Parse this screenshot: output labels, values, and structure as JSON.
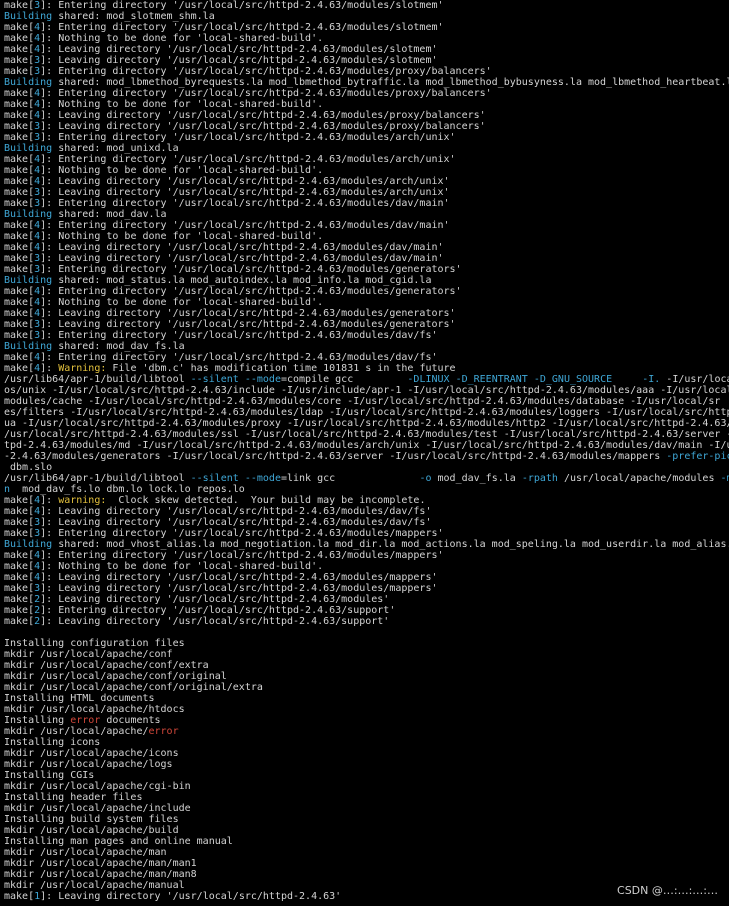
{
  "colors": {
    "background": "#000000",
    "text": "#d4d4d4",
    "accent_blue": "#3fa7d6",
    "warning_yellow": "#e3c13d",
    "error_red": "#d0473a"
  },
  "watermark": "CSDN @…:…:…:…",
  "lines": [
    [
      {
        "t": "make[",
        "c": "txt"
      },
      {
        "t": "3",
        "c": "num"
      },
      {
        "t": "]: Entering directory '/usr/local/src/httpd-2.4.63/modules/slotmem'",
        "c": "txt"
      }
    ],
    [
      {
        "t": "Building",
        "c": "build"
      },
      {
        "t": " shared: mod_slotmem_shm.la",
        "c": "txt"
      }
    ],
    [
      {
        "t": "make[",
        "c": "txt"
      },
      {
        "t": "4",
        "c": "num"
      },
      {
        "t": "]: Entering directory '/usr/local/src/httpd-2.4.63/modules/slotmem'",
        "c": "txt"
      }
    ],
    [
      {
        "t": "make[",
        "c": "txt"
      },
      {
        "t": "4",
        "c": "num"
      },
      {
        "t": "]: Nothing to be done for 'local-shared-build'.",
        "c": "txt"
      }
    ],
    [
      {
        "t": "make[",
        "c": "txt"
      },
      {
        "t": "4",
        "c": "num"
      },
      {
        "t": "]: Leaving directory '/usr/local/src/httpd-2.4.63/modules/slotmem'",
        "c": "txt"
      }
    ],
    [
      {
        "t": "make[",
        "c": "txt"
      },
      {
        "t": "3",
        "c": "num"
      },
      {
        "t": "]: Leaving directory '/usr/local/src/httpd-2.4.63/modules/slotmem'",
        "c": "txt"
      }
    ],
    [
      {
        "t": "make[",
        "c": "txt"
      },
      {
        "t": "3",
        "c": "num"
      },
      {
        "t": "]: Entering directory '/usr/local/src/httpd-2.4.63/modules/proxy/balancers'",
        "c": "txt"
      }
    ],
    [
      {
        "t": "Building",
        "c": "build"
      },
      {
        "t": " shared: mod_lbmethod_byrequests.la mod_lbmethod_bytraffic.la mod_lbmethod_bybusyness.la mod_lbmethod_heartbeat.la",
        "c": "txt"
      }
    ],
    [
      {
        "t": "make[",
        "c": "txt"
      },
      {
        "t": "4",
        "c": "num"
      },
      {
        "t": "]: Entering directory '/usr/local/src/httpd-2.4.63/modules/proxy/balancers'",
        "c": "txt"
      }
    ],
    [
      {
        "t": "make[",
        "c": "txt"
      },
      {
        "t": "4",
        "c": "num"
      },
      {
        "t": "]: Nothing to be done for 'local-shared-build'.",
        "c": "txt"
      }
    ],
    [
      {
        "t": "make[",
        "c": "txt"
      },
      {
        "t": "4",
        "c": "num"
      },
      {
        "t": "]: Leaving directory '/usr/local/src/httpd-2.4.63/modules/proxy/balancers'",
        "c": "txt"
      }
    ],
    [
      {
        "t": "make[",
        "c": "txt"
      },
      {
        "t": "3",
        "c": "num"
      },
      {
        "t": "]: Leaving directory '/usr/local/src/httpd-2.4.63/modules/proxy/balancers'",
        "c": "txt"
      }
    ],
    [
      {
        "t": "make[",
        "c": "txt"
      },
      {
        "t": "3",
        "c": "num"
      },
      {
        "t": "]: Entering directory '/usr/local/src/httpd-2.4.63/modules/arch/unix'",
        "c": "txt"
      }
    ],
    [
      {
        "t": "Building",
        "c": "build"
      },
      {
        "t": " shared: mod_unixd.la",
        "c": "txt"
      }
    ],
    [
      {
        "t": "make[",
        "c": "txt"
      },
      {
        "t": "4",
        "c": "num"
      },
      {
        "t": "]: Entering directory '/usr/local/src/httpd-2.4.63/modules/arch/unix'",
        "c": "txt"
      }
    ],
    [
      {
        "t": "make[",
        "c": "txt"
      },
      {
        "t": "4",
        "c": "num"
      },
      {
        "t": "]: Nothing to be done for 'local-shared-build'.",
        "c": "txt"
      }
    ],
    [
      {
        "t": "make[",
        "c": "txt"
      },
      {
        "t": "4",
        "c": "num"
      },
      {
        "t": "]: Leaving directory '/usr/local/src/httpd-2.4.63/modules/arch/unix'",
        "c": "txt"
      }
    ],
    [
      {
        "t": "make[",
        "c": "txt"
      },
      {
        "t": "3",
        "c": "num"
      },
      {
        "t": "]: Leaving directory '/usr/local/src/httpd-2.4.63/modules/arch/unix'",
        "c": "txt"
      }
    ],
    [
      {
        "t": "make[",
        "c": "txt"
      },
      {
        "t": "3",
        "c": "num"
      },
      {
        "t": "]: Entering directory '/usr/local/src/httpd-2.4.63/modules/dav/main'",
        "c": "txt"
      }
    ],
    [
      {
        "t": "Building",
        "c": "build"
      },
      {
        "t": " shared: mod_dav.la",
        "c": "txt"
      }
    ],
    [
      {
        "t": "make[",
        "c": "txt"
      },
      {
        "t": "4",
        "c": "num"
      },
      {
        "t": "]: Entering directory '/usr/local/src/httpd-2.4.63/modules/dav/main'",
        "c": "txt"
      }
    ],
    [
      {
        "t": "make[",
        "c": "txt"
      },
      {
        "t": "4",
        "c": "num"
      },
      {
        "t": "]: Nothing to be done for 'local-shared-build'.",
        "c": "txt"
      }
    ],
    [
      {
        "t": "make[",
        "c": "txt"
      },
      {
        "t": "4",
        "c": "num"
      },
      {
        "t": "]: Leaving directory '/usr/local/src/httpd-2.4.63/modules/dav/main'",
        "c": "txt"
      }
    ],
    [
      {
        "t": "make[",
        "c": "txt"
      },
      {
        "t": "3",
        "c": "num"
      },
      {
        "t": "]: Leaving directory '/usr/local/src/httpd-2.4.63/modules/dav/main'",
        "c": "txt"
      }
    ],
    [
      {
        "t": "make[",
        "c": "txt"
      },
      {
        "t": "3",
        "c": "num"
      },
      {
        "t": "]: Entering directory '/usr/local/src/httpd-2.4.63/modules/generators'",
        "c": "txt"
      }
    ],
    [
      {
        "t": "Building",
        "c": "build"
      },
      {
        "t": " shared: mod_status.la mod_autoindex.la mod_info.la mod_cgid.la",
        "c": "txt"
      }
    ],
    [
      {
        "t": "make[",
        "c": "txt"
      },
      {
        "t": "4",
        "c": "num"
      },
      {
        "t": "]: Entering directory '/usr/local/src/httpd-2.4.63/modules/generators'",
        "c": "txt"
      }
    ],
    [
      {
        "t": "make[",
        "c": "txt"
      },
      {
        "t": "4",
        "c": "num"
      },
      {
        "t": "]: Nothing to be done for 'local-shared-build'.",
        "c": "txt"
      }
    ],
    [
      {
        "t": "make[",
        "c": "txt"
      },
      {
        "t": "4",
        "c": "num"
      },
      {
        "t": "]: Leaving directory '/usr/local/src/httpd-2.4.63/modules/generators'",
        "c": "txt"
      }
    ],
    [
      {
        "t": "make[",
        "c": "txt"
      },
      {
        "t": "3",
        "c": "num"
      },
      {
        "t": "]: Leaving directory '/usr/local/src/httpd-2.4.63/modules/generators'",
        "c": "txt"
      }
    ],
    [
      {
        "t": "make[",
        "c": "txt"
      },
      {
        "t": "3",
        "c": "num"
      },
      {
        "t": "]: Entering directory '/usr/local/src/httpd-2.4.63/modules/dav/fs'",
        "c": "txt"
      }
    ],
    [
      {
        "t": "Building",
        "c": "build"
      },
      {
        "t": " shared: mod_dav_fs.la",
        "c": "txt"
      }
    ],
    [
      {
        "t": "make[",
        "c": "txt"
      },
      {
        "t": "4",
        "c": "num"
      },
      {
        "t": "]: Entering directory '/usr/local/src/httpd-2.4.63/modules/dav/fs'",
        "c": "txt"
      }
    ],
    [
      {
        "t": "make[",
        "c": "txt"
      },
      {
        "t": "4",
        "c": "num"
      },
      {
        "t": "]: ",
        "c": "txt"
      },
      {
        "t": "Warning:",
        "c": "warn"
      },
      {
        "t": " File 'dbm.c' has modification time 101831 s in the future",
        "c": "txt"
      }
    ],
    [
      {
        "t": "/usr/lib64/apr-1/build/libtool ",
        "c": "txt"
      },
      {
        "t": "--silent",
        "c": "flag"
      },
      {
        "t": " ",
        "c": "txt"
      },
      {
        "t": "--mode",
        "c": "flag"
      },
      {
        "t": "=compile gcc         ",
        "c": "txt"
      },
      {
        "t": "-DLINUX -D_REENTRANT -D_GNU_SOURCE",
        "c": "flag"
      },
      {
        "t": "     ",
        "c": "txt"
      },
      {
        "t": "-I.",
        "c": "flag"
      },
      {
        "t": " -I/usr/local",
        "c": "txt"
      }
    ],
    [
      {
        "t": "os/unix -I/usr/local/src/httpd-2.4.63/include -I/usr/include/apr-1 -I/usr/local/src/httpd-2.4.63/modules/aaa -I/usr/local",
        "c": "txt"
      }
    ],
    [
      {
        "t": "modules/cache -I/usr/local/src/httpd-2.4.63/modules/core -I/usr/local/src/httpd-2.4.63/modules/database -I/usr/local/sr",
        "c": "txt"
      }
    ],
    [
      {
        "t": "es/filters -I/usr/local/src/httpd-2.4.63/modules/ldap -I/usr/local/src/httpd-2.4.63/modules/loggers -I/usr/local/src/http",
        "c": "txt"
      }
    ],
    [
      {
        "t": "ua -I/usr/local/src/httpd-2.4.63/modules/proxy -I/usr/local/src/httpd-2.4.63/modules/http2 -I/usr/local/src/httpd-2.4.63/",
        "c": "txt"
      }
    ],
    [
      {
        "t": "/usr/local/src/httpd-2.4.63/modules/ssl -I/usr/local/src/httpd-2.4.63/modules/test -I/usr/local/src/httpd-2.4.63/server -",
        "c": "txt"
      }
    ],
    [
      {
        "t": "tpd-2.4.63/modules/md -I/usr/local/src/httpd-2.4.63/modules/arch/unix -I/usr/local/src/httpd-2.4.63/modules/dav/main -I/us",
        "c": "txt"
      }
    ],
    [
      {
        "t": "-2.4.63/modules/generators -I/usr/local/src/httpd-2.4.63/server -I/usr/local/src/httpd-2.4.63/modules/mappers ",
        "c": "txt"
      },
      {
        "t": "-prefer-pic",
        "c": "flag"
      }
    ],
    [
      {
        "t": " dbm.slo",
        "c": "txt"
      }
    ],
    [
      {
        "t": "/usr/lib64/apr-1/build/libtool ",
        "c": "txt"
      },
      {
        "t": "--silent",
        "c": "flag"
      },
      {
        "t": " ",
        "c": "txt"
      },
      {
        "t": "--mode",
        "c": "flag"
      },
      {
        "t": "=link gcc              ",
        "c": "txt"
      },
      {
        "t": "-o",
        "c": "flag"
      },
      {
        "t": " mod_dav_fs.la ",
        "c": "txt"
      },
      {
        "t": "-rpath",
        "c": "flag"
      },
      {
        "t": " /usr/local/apache/modules ",
        "c": "txt"
      },
      {
        "t": "-mo",
        "c": "flag"
      }
    ],
    [
      {
        "t": "n",
        "c": "flag"
      },
      {
        "t": "  mod_dav_fs.lo dbm.lo lock.lo repos.lo",
        "c": "txt"
      }
    ],
    [
      {
        "t": "make[",
        "c": "txt"
      },
      {
        "t": "4",
        "c": "num"
      },
      {
        "t": "]: ",
        "c": "txt"
      },
      {
        "t": "warning:",
        "c": "warn"
      },
      {
        "t": "  Clock skew detected.  Your build may be incomplete.",
        "c": "txt"
      }
    ],
    [
      {
        "t": "make[",
        "c": "txt"
      },
      {
        "t": "4",
        "c": "num"
      },
      {
        "t": "]: Leaving directory '/usr/local/src/httpd-2.4.63/modules/dav/fs'",
        "c": "txt"
      }
    ],
    [
      {
        "t": "make[",
        "c": "txt"
      },
      {
        "t": "3",
        "c": "num"
      },
      {
        "t": "]: Leaving directory '/usr/local/src/httpd-2.4.63/modules/dav/fs'",
        "c": "txt"
      }
    ],
    [
      {
        "t": "make[",
        "c": "txt"
      },
      {
        "t": "3",
        "c": "num"
      },
      {
        "t": "]: Entering directory '/usr/local/src/httpd-2.4.63/modules/mappers'",
        "c": "txt"
      }
    ],
    [
      {
        "t": "Building",
        "c": "build"
      },
      {
        "t": " shared: mod_vhost_alias.la mod_negotiation.la mod_dir.la mod_actions.la mod_speling.la mod_userdir.la mod_alias.",
        "c": "txt"
      }
    ],
    [
      {
        "t": "make[",
        "c": "txt"
      },
      {
        "t": "4",
        "c": "num"
      },
      {
        "t": "]: Entering directory '/usr/local/src/httpd-2.4.63/modules/mappers'",
        "c": "txt"
      }
    ],
    [
      {
        "t": "make[",
        "c": "txt"
      },
      {
        "t": "4",
        "c": "num"
      },
      {
        "t": "]: Nothing to be done for 'local-shared-build'.",
        "c": "txt"
      }
    ],
    [
      {
        "t": "make[",
        "c": "txt"
      },
      {
        "t": "4",
        "c": "num"
      },
      {
        "t": "]: Leaving directory '/usr/local/src/httpd-2.4.63/modules/mappers'",
        "c": "txt"
      }
    ],
    [
      {
        "t": "make[",
        "c": "txt"
      },
      {
        "t": "3",
        "c": "num"
      },
      {
        "t": "]: Leaving directory '/usr/local/src/httpd-2.4.63/modules/mappers'",
        "c": "txt"
      }
    ],
    [
      {
        "t": "make[",
        "c": "txt"
      },
      {
        "t": "2",
        "c": "num"
      },
      {
        "t": "]: Leaving directory '/usr/local/src/httpd-2.4.63/modules'",
        "c": "txt"
      }
    ],
    [
      {
        "t": "make[",
        "c": "txt"
      },
      {
        "t": "2",
        "c": "num"
      },
      {
        "t": "]: Entering directory '/usr/local/src/httpd-2.4.63/support'",
        "c": "txt"
      }
    ],
    [
      {
        "t": "make[",
        "c": "txt"
      },
      {
        "t": "2",
        "c": "num"
      },
      {
        "t": "]: Leaving directory '/usr/local/src/httpd-2.4.63/support'",
        "c": "txt"
      }
    ],
    [
      {
        "t": "",
        "c": "txt"
      }
    ],
    [
      {
        "t": "Installing configuration files",
        "c": "txt"
      }
    ],
    [
      {
        "t": "mkdir /usr/local/apache/conf",
        "c": "txt"
      }
    ],
    [
      {
        "t": "mkdir /usr/local/apache/conf/extra",
        "c": "txt"
      }
    ],
    [
      {
        "t": "mkdir /usr/local/apache/conf/original",
        "c": "txt"
      }
    ],
    [
      {
        "t": "mkdir /usr/local/apache/conf/original/extra",
        "c": "txt"
      }
    ],
    [
      {
        "t": "Installing HTML documents",
        "c": "txt"
      }
    ],
    [
      {
        "t": "mkdir /usr/local/apache/htdocs",
        "c": "txt"
      }
    ],
    [
      {
        "t": "Installing ",
        "c": "txt"
      },
      {
        "t": "error",
        "c": "err"
      },
      {
        "t": " documents",
        "c": "txt"
      }
    ],
    [
      {
        "t": "mkdir /usr/local/apache/",
        "c": "txt"
      },
      {
        "t": "error",
        "c": "err"
      }
    ],
    [
      {
        "t": "Installing icons",
        "c": "txt"
      }
    ],
    [
      {
        "t": "mkdir /usr/local/apache/icons",
        "c": "txt"
      }
    ],
    [
      {
        "t": "mkdir /usr/local/apache/logs",
        "c": "txt"
      }
    ],
    [
      {
        "t": "Installing CGIs",
        "c": "txt"
      }
    ],
    [
      {
        "t": "mkdir /usr/local/apache/cgi-bin",
        "c": "txt"
      }
    ],
    [
      {
        "t": "Installing header files",
        "c": "txt"
      }
    ],
    [
      {
        "t": "mkdir /usr/local/apache/include",
        "c": "txt"
      }
    ],
    [
      {
        "t": "Installing build system files",
        "c": "txt"
      }
    ],
    [
      {
        "t": "mkdir /usr/local/apache/build",
        "c": "txt"
      }
    ],
    [
      {
        "t": "Installing man pages and online manual",
        "c": "txt"
      }
    ],
    [
      {
        "t": "mkdir /usr/local/apache/man",
        "c": "txt"
      }
    ],
    [
      {
        "t": "mkdir /usr/local/apache/man/man1",
        "c": "txt"
      }
    ],
    [
      {
        "t": "mkdir /usr/local/apache/man/man8",
        "c": "txt"
      }
    ],
    [
      {
        "t": "mkdir /usr/local/apache/manual",
        "c": "txt"
      }
    ],
    [
      {
        "t": "make[",
        "c": "txt"
      },
      {
        "t": "1",
        "c": "num"
      },
      {
        "t": "]: Leaving directory '/usr/local/src/httpd-2.4.63'",
        "c": "txt"
      }
    ]
  ]
}
